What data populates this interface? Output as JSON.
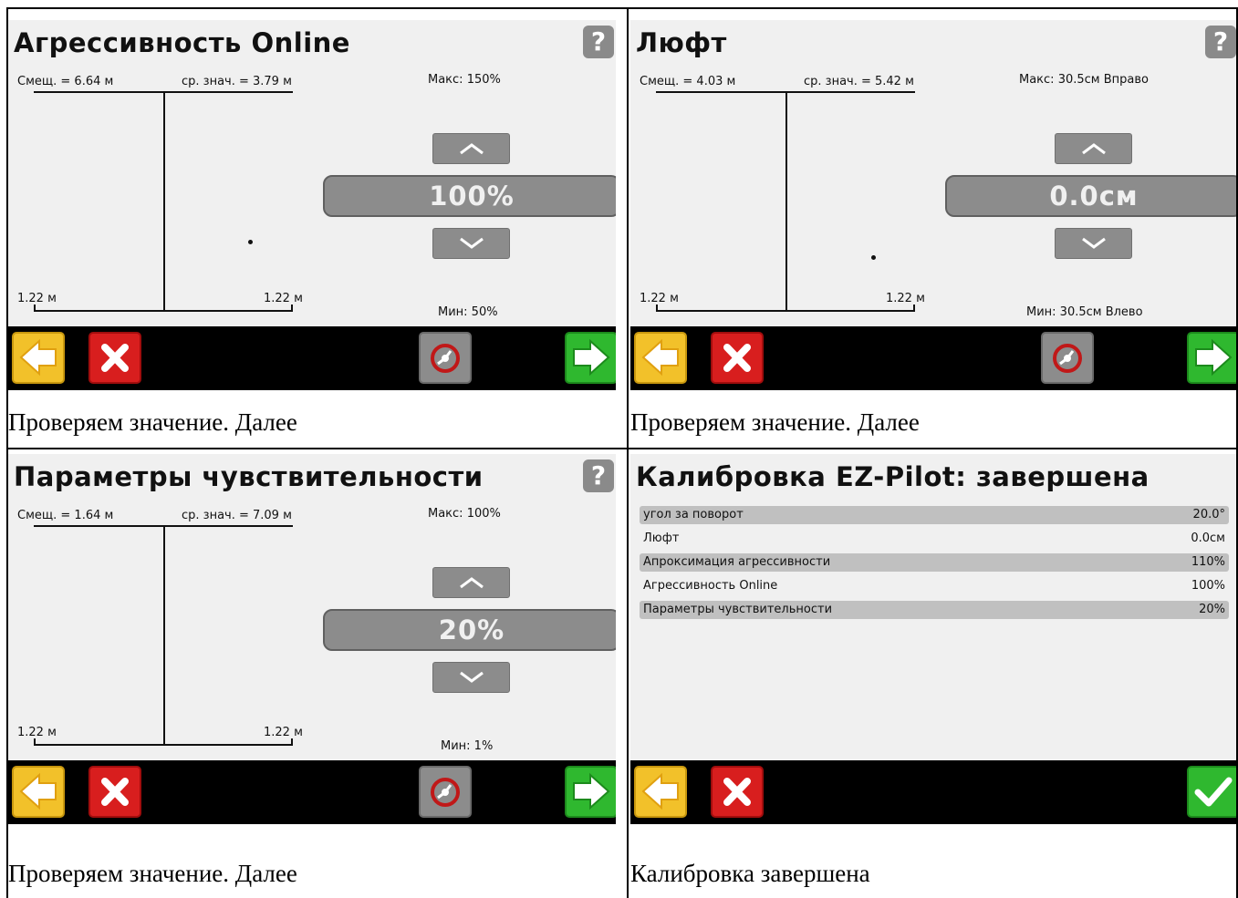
{
  "panels": [
    {
      "title": "Агрессивность Online",
      "help": "?",
      "offset": "Смещ. = 6.64 м",
      "avg": "ср. знач. = 3.79 м",
      "max": "Макс: 150%",
      "min": "Мин: 50%",
      "value": "100%",
      "left_scale": "1.22 м",
      "right_scale": "1.22 м",
      "caption": "Проверяем значение. Далее"
    },
    {
      "title": "Люфт",
      "help": "?",
      "offset": "Смещ. = 4.03 м",
      "avg": "ср. знач. = 5.42 м",
      "max": "Макс: 30.5см Вправо",
      "min": "Мин: 30.5см Влево",
      "value": "0.0см",
      "left_scale": "1.22 м",
      "right_scale": "1.22 м",
      "caption": "Проверяем значение. Далее"
    },
    {
      "title": "Параметры чувствительности",
      "help": "?",
      "offset": "Смещ. = 1.64 м",
      "avg": "ср. знач. = 7.09 м",
      "max": "Макс: 100%",
      "min": "Мин: 1%",
      "value": "20%",
      "left_scale": "1.22 м",
      "right_scale": "1.22 м",
      "caption": "Проверяем значение. Далее"
    }
  ],
  "summary": {
    "title": "Калибровка EZ-Pilot: завершена",
    "rows": [
      {
        "label": "угол за поворот",
        "value": "20.0°"
      },
      {
        "label": "Люфт",
        "value": "0.0см"
      },
      {
        "label": "Апроксимация агрессивности",
        "value": "110%"
      },
      {
        "label": "Агрессивность Online",
        "value": "100%"
      },
      {
        "label": "Параметры чувствительности",
        "value": "20%"
      }
    ],
    "caption": "Калибровка завершена"
  },
  "colors": {
    "back": "#f2c12a",
    "cancel": "#d81e1e",
    "next": "#2fb82f",
    "screen_bg": "#f0f0f0",
    "toolbar_bg": "#000000",
    "control_gray": "#8c8c8c"
  },
  "icons": {
    "back": "arrow-left-icon",
    "cancel": "close-icon",
    "wheel": "steering-wheel-icon",
    "next": "arrow-right-icon",
    "finish": "checkmark-icon",
    "up": "chevron-up-icon",
    "down": "chevron-down-icon"
  }
}
